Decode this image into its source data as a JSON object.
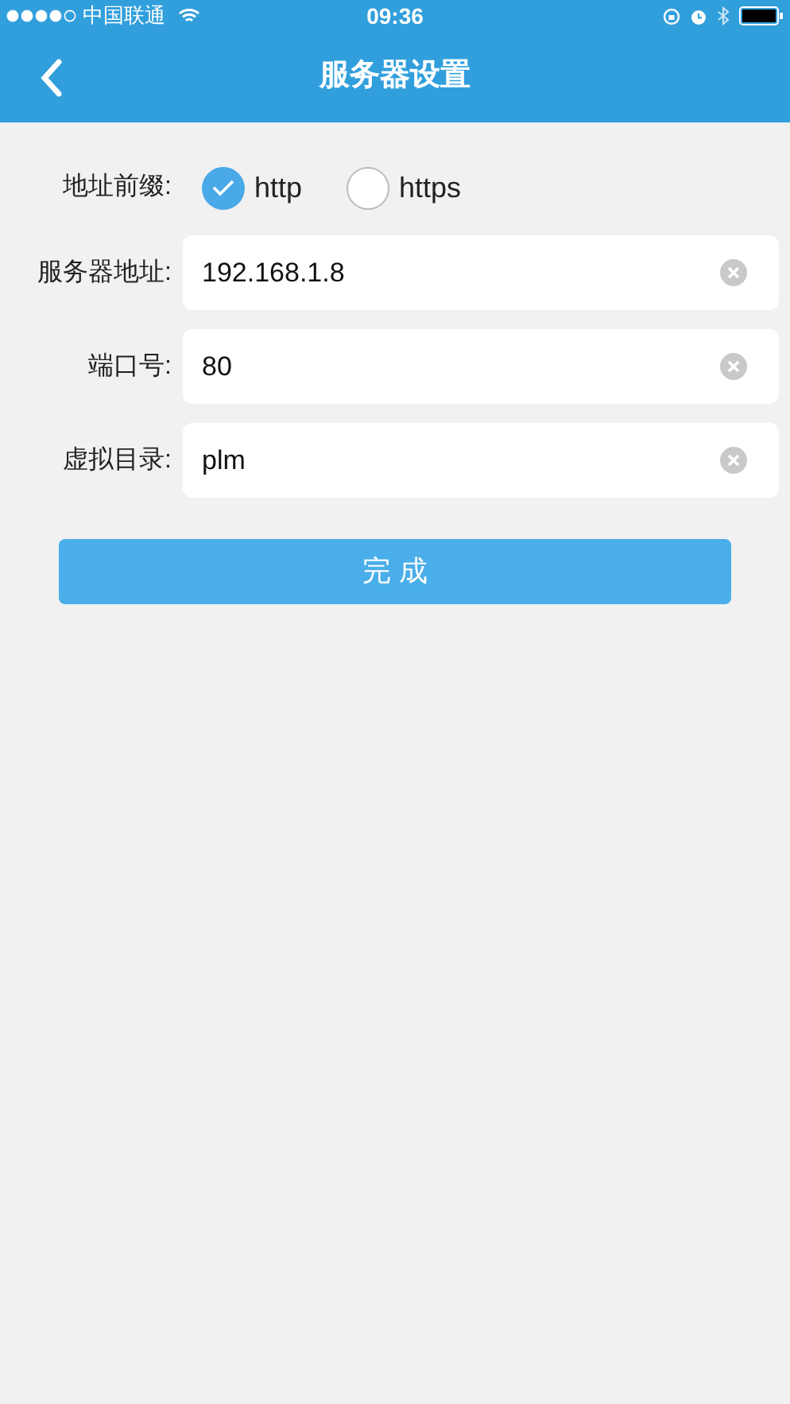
{
  "status_bar": {
    "carrier": "中国联通",
    "time": "09:36"
  },
  "nav": {
    "title": "服务器设置"
  },
  "prefix": {
    "label": "地址前缀:",
    "options": [
      {
        "label": "http",
        "selected": true
      },
      {
        "label": "https",
        "selected": false
      }
    ]
  },
  "fields": [
    {
      "label": "服务器地址:",
      "value": "192.168.1.8"
    },
    {
      "label": "端口号:",
      "value": "80"
    },
    {
      "label": "虚拟目录:",
      "value": "plm"
    }
  ],
  "done_button": "完 成"
}
